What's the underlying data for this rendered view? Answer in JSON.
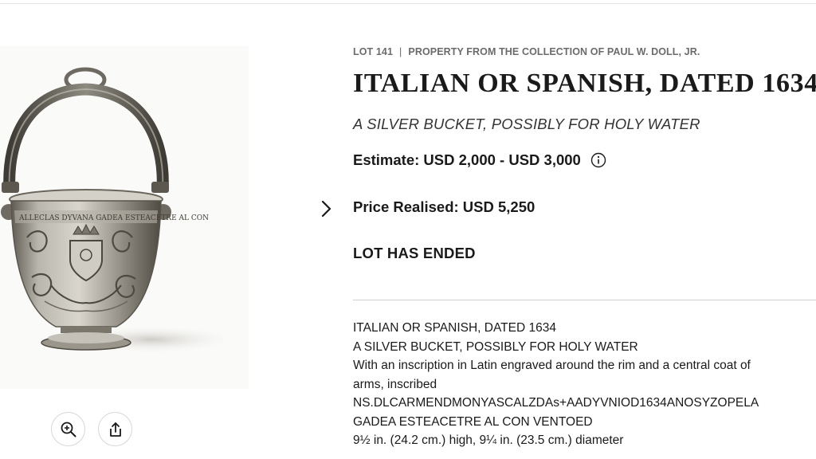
{
  "lot": {
    "number": "LOT 141",
    "separator": "|",
    "provenance": "PROPERTY FROM THE COLLECTION OF PAUL W. DOLL, JR.",
    "title": "ITALIAN OR SPANISH, DATED 1634",
    "subtitle": "A SILVER BUCKET, POSSIBLY FOR HOLY WATER",
    "estimate": "Estimate: USD 2,000 - USD 3,000",
    "price_realised": "Price Realised: USD 5,250",
    "status": "LOT HAS ENDED"
  },
  "image": {
    "alt": "A silver bucket with swing handle, engraved with scrolling foliage and a central coat of arms",
    "inscription": "ALLECLAS DYVANA GADEA ESTEACETRE AL CON"
  },
  "description": {
    "lines": [
      "ITALIAN OR SPANISH, DATED 1634",
      "A SILVER BUCKET, POSSIBLY FOR HOLY WATER",
      "With an inscription in Latin engraved around the rim and a central coat of",
      "arms, inscribed",
      "NS.DLCARMENDMONYASCALZDAs+AADYVNIOD1634ANOSYZOPELA",
      "GADEA ESTEACETRE AL CON VENTOED"
    ],
    "dimensions_parts": {
      "a_whole": "9",
      "a_frac": "½",
      "a_rest": " in. (24.2 cm.) high, 9",
      "b_frac": "¼",
      "b_rest": " in. (23.5 cm.) diameter"
    }
  },
  "icons": {
    "zoom": "zoom-in-icon",
    "share": "share-icon",
    "info": "info-icon",
    "chevron": "chevron-right-icon"
  },
  "colors": {
    "text": "#1a1a1a",
    "muted": "#6b6b6b",
    "divider": "#cfcfcf",
    "silver": "#a7a49b"
  }
}
